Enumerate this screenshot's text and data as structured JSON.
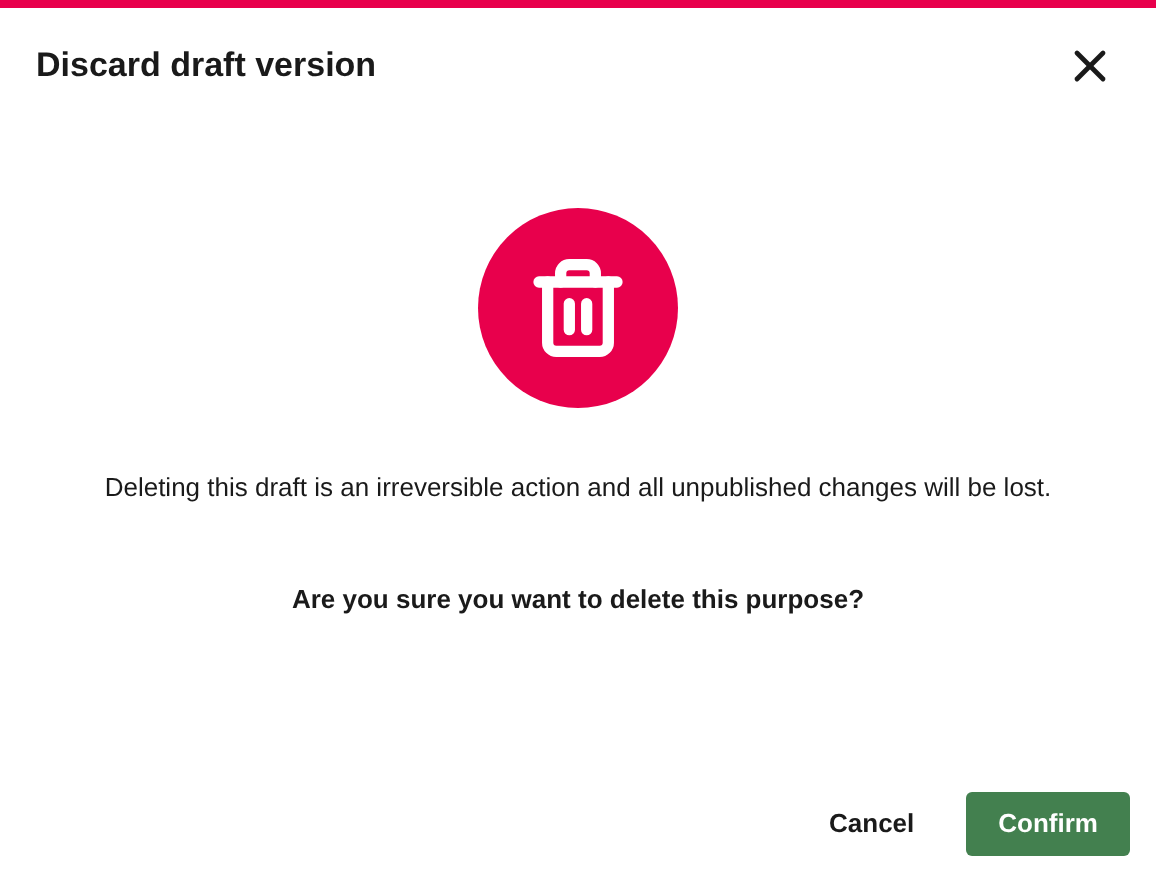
{
  "dialog": {
    "title": "Discard draft version",
    "message": "Deleting this draft is an irreversible action and all unpublished changes will be lost.",
    "question": "Are you sure you want to delete this purpose?",
    "buttons": [
      {
        "label": "Cancel",
        "kind": "secondary"
      },
      {
        "label": "Confirm",
        "kind": "primary"
      }
    ]
  }
}
